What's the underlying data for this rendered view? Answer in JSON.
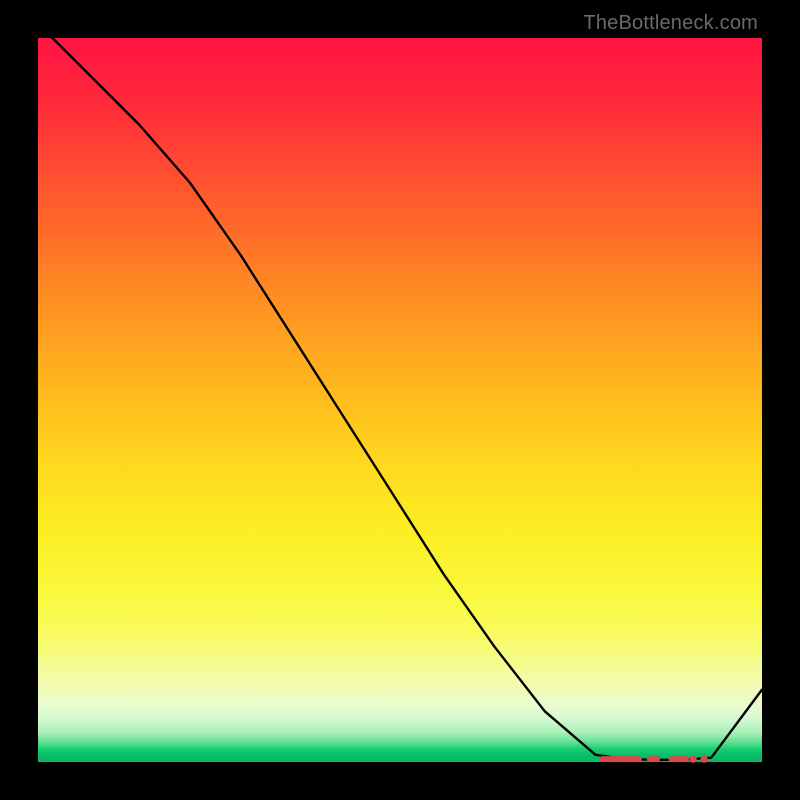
{
  "watermark": "TheBottleneck.com",
  "chart_data": {
    "type": "line",
    "title": "",
    "xlabel": "",
    "ylabel": "",
    "xlim": [
      0,
      100
    ],
    "ylim": [
      0,
      100
    ],
    "grid": false,
    "legend": false,
    "series": [
      {
        "name": "curve",
        "x": [
          0,
          7,
          14,
          21,
          28,
          35,
          42,
          49,
          56,
          63,
          70,
          77,
          81,
          85,
          89,
          93,
          100
        ],
        "values": [
          102,
          95,
          88,
          80,
          70,
          59,
          48,
          37,
          26,
          16,
          7,
          1,
          0.4,
          0.3,
          0.3,
          0.6,
          10
        ]
      }
    ],
    "markers": {
      "y": 0.4,
      "x_segments": [
        [
          78,
          83
        ],
        [
          84.5,
          85.5
        ],
        [
          87.5,
          89.5
        ]
      ],
      "x_dots": [
        90.5,
        92
      ]
    }
  }
}
